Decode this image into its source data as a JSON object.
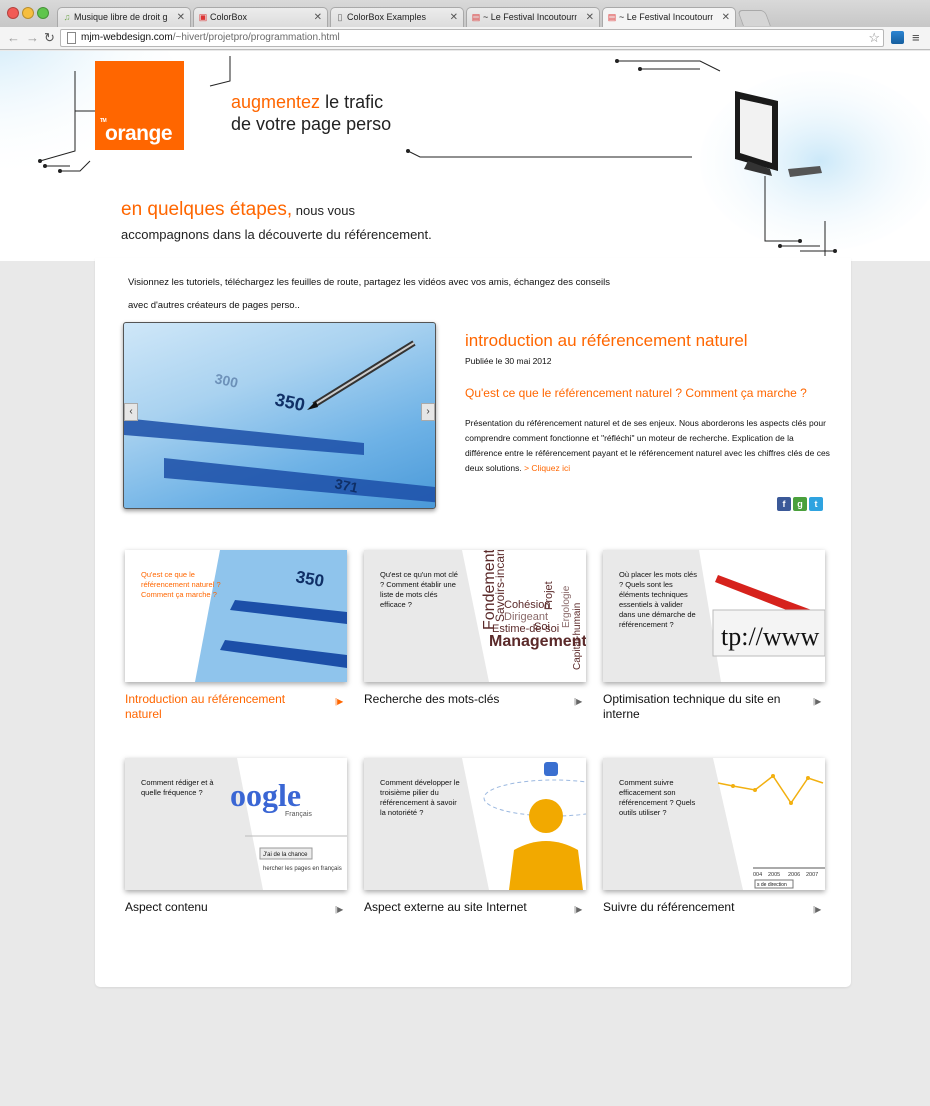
{
  "browser": {
    "tabs": [
      {
        "title": "Musique libre de droit gratu",
        "favicon": "music-icon"
      },
      {
        "title": "ColorBox",
        "favicon": "colorbox-icon"
      },
      {
        "title": "ColorBox Examples",
        "favicon": "page-icon"
      },
      {
        "title": "~ Le Festival Incoutournable",
        "favicon": "festival-icon"
      },
      {
        "title": "~ Le Festival Incoutournable",
        "favicon": "festival-icon"
      }
    ],
    "active_tab": 4,
    "url_domain": "mjm-webdesign.com",
    "url_path": "/~hivert/projetpro/programmation.html"
  },
  "header": {
    "logo_text": "orange",
    "logo_tm": "TM",
    "tagline_highlight": "augmentez",
    "tagline_line1_rest": " le trafic",
    "tagline_line2": "de votre page perso"
  },
  "intro": {
    "highlight": "en quelques étapes,",
    "line1_rest": " nous vous",
    "line2": "accompagnons dans la découverte du référencement."
  },
  "lead_text": "Visionnez les tutoriels, téléchargez les feuilles de route, partagez les vidéos avec vos amis, échangez des conseils avec d'autres créateurs de pages perso..",
  "slider": {
    "prev": "‹",
    "next": "›"
  },
  "feature": {
    "title": "introduction au référencement naturel",
    "date": "Publiée le 30 mai 2012",
    "subtitle": "Qu'est ce que le référencement naturel ? Comment ça marche ?",
    "description": "Présentation du référencement naturel et de ses enjeux. Nous aborderons les aspects clés pour comprendre comment fonctionne et \"réfléchi\" un moteur de recherche. Explication de la différence entre le référencement payant et le référencement naturel avec les chiffres clés de ces deux solutions.",
    "link": "> Cliquez ici"
  },
  "share": [
    {
      "name": "facebook-icon",
      "glyph": "f",
      "color": "#3b5998"
    },
    {
      "name": "google-icon",
      "glyph": "g",
      "color": "#4aa03c"
    },
    {
      "name": "twitter-icon",
      "glyph": "t",
      "color": "#2fa3e0"
    }
  ],
  "cards": [
    {
      "title": "Introduction au référencement naturel",
      "question": "Qu'est ce que le référencement naturel ? Comment ça marche ?",
      "active": true
    },
    {
      "title": "Recherche des mots-clés",
      "question": "Qu'est ce qu'un mot clé ? Comment établir une liste de mots clés efficace ?",
      "active": false
    },
    {
      "title": "Optimisation technique du site en interne",
      "question": "Où placer les mots clés ? Quels sont les éléments techniques essentiels à valider dans une démarche de référencement ?",
      "active": false
    },
    {
      "title": "Aspect contenu",
      "question": "Comment rédiger et à quelle fréquence ?",
      "active": false
    },
    {
      "title": "Aspect externe au site Internet",
      "question": "Comment développer le troisième pilier du référencement à savoir la notoriété ?",
      "active": false
    },
    {
      "title": "Suivre du référencement",
      "question": "Comment suivre efficacement son référencement ? Quels outils utiliser ?",
      "active": false
    }
  ],
  "card_arrow": "|▶",
  "card_image_text": {
    "chart_number": "350",
    "keywords": [
      "Fondement",
      "Savoirs-incarné",
      "Cohésion",
      "Dirigeant",
      "Estime-de-soi",
      "Management",
      "Soi",
      "Projet",
      "Ergologie",
      "Capital-humain"
    ],
    "url_fragment": "tp://www",
    "google_logo": "oogle",
    "google_lang": "Français",
    "google_button": "J'ai de la chance",
    "google_hint": "hercher les pages en français",
    "years": [
      "004",
      "2005",
      "2006",
      "2007"
    ],
    "direction_label": "s de direction"
  },
  "colors": {
    "accent": "#ff6600",
    "page_bg": "#e9e9e9"
  }
}
